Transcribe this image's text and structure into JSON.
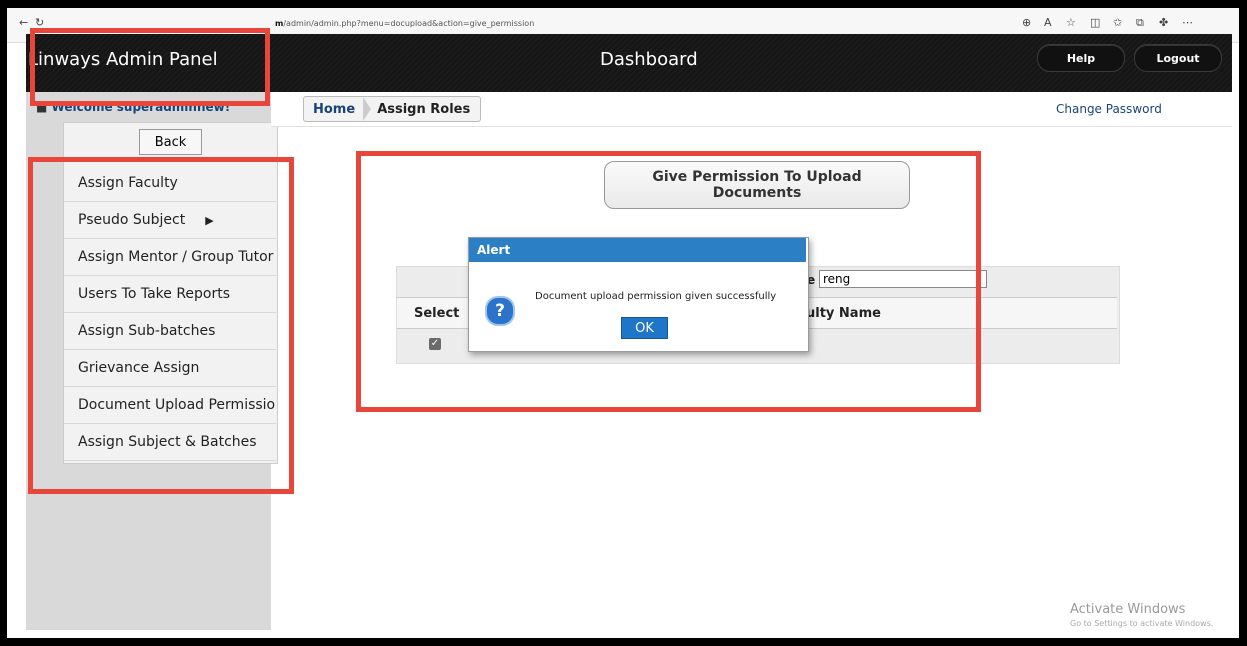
{
  "browser": {
    "url_prefix": "m",
    "url_path": "/admin/admin.php?menu=docupload&action=give_permission"
  },
  "header": {
    "brand": "Linways Admin Panel",
    "title": "Dashboard",
    "help_label": "Help",
    "logout_label": "Logout"
  },
  "sidebar": {
    "welcome": "Welcome superadminnew!",
    "back_label": "Back",
    "items": [
      {
        "label": "Assign Faculty"
      },
      {
        "label": "Pseudo Subject"
      },
      {
        "label": "Assign Mentor / Group Tutor"
      },
      {
        "label": "Users To Take Reports"
      },
      {
        "label": "Assign Sub-batches"
      },
      {
        "label": "Grievance Assign"
      },
      {
        "label": "Document Upload Permission"
      },
      {
        "label": "Assign Subject & Batches"
      }
    ]
  },
  "breadcrumb": {
    "home": "Home",
    "current": "Assign Roles"
  },
  "change_password": "Change Password",
  "main": {
    "permission_button": "Give Permission To Upload Documents",
    "filter_label": "e :",
    "filter_value": "reng",
    "col_select": "Select",
    "col_name": "ulty Name"
  },
  "alert": {
    "title": "Alert",
    "message": "Document upload permission given successfully",
    "ok_label": "OK"
  },
  "watermark": {
    "line1": "Activate Windows",
    "line2": "Go to Settings to activate Windows."
  },
  "colors": {
    "header_bg": "#1b1b1b",
    "link_blue": "#17457a",
    "alert_blue": "#2b80c5",
    "highlight_red": "#e8463b"
  }
}
